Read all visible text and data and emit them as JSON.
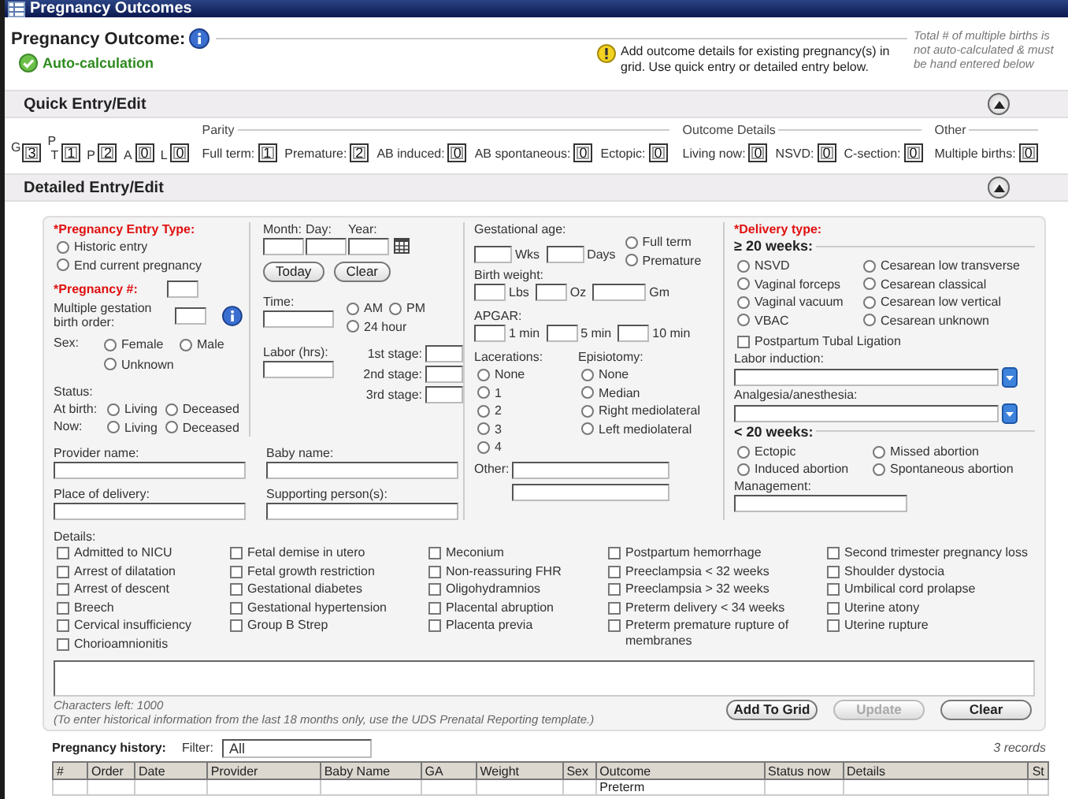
{
  "window": {
    "title": "Pregnancy Outcomes"
  },
  "header": {
    "title": "Pregnancy Outcome:",
    "auto_calc": "Auto-calculation",
    "notice": "Add outcome details for existing pregnancy(s) in grid. Use quick entry or detailed entry below.",
    "note": "Total # of multiple births is not auto-calculated & must be hand entered below"
  },
  "quick_entry": {
    "title": "Quick Entry/Edit",
    "expanded": true,
    "gravida": {
      "label": "G",
      "value": "3"
    },
    "para_label": "P",
    "para": [
      {
        "label": "T",
        "value": "1"
      },
      {
        "label": "P",
        "value": "2"
      },
      {
        "label": "A",
        "value": "0"
      },
      {
        "label": "L",
        "value": "0"
      }
    ],
    "groups": [
      {
        "title": "Parity",
        "fields": [
          {
            "label": "Full term:",
            "value": "1"
          },
          {
            "label": "Premature:",
            "value": "2"
          },
          {
            "label": "AB induced:",
            "value": "0"
          },
          {
            "label": "AB spontaneous:",
            "value": "0"
          },
          {
            "label": "Ectopic:",
            "value": "0"
          }
        ]
      },
      {
        "title": "Outcome Details",
        "fields": [
          {
            "label": "Living now:",
            "value": "0"
          },
          {
            "label": "NSVD:",
            "value": "0"
          },
          {
            "label": "C-section:",
            "value": "0"
          }
        ]
      },
      {
        "title": "Other",
        "fields": [
          {
            "label": "Multiple births:",
            "value": "0"
          }
        ]
      }
    ]
  },
  "detailed_entry": {
    "title": "Detailed Entry/Edit",
    "expanded": true,
    "entry_type": {
      "label": "*Pregnancy Entry Type:",
      "required": true,
      "options": [
        {
          "label": "Historic entry",
          "selected": false
        },
        {
          "label": "End current pregnancy",
          "selected": false
        }
      ]
    },
    "pregnancy_number": {
      "label": "*Pregnancy #:",
      "required": true
    },
    "birth_order": {
      "label": "Multiple gestation birth order:"
    },
    "sex": {
      "label": "Sex:",
      "options": [
        {
          "label": "Female",
          "selected": false
        },
        {
          "label": "Male",
          "selected": false
        },
        {
          "label": "Unknown",
          "selected": false
        }
      ]
    },
    "status": {
      "label": "Status:",
      "rows": [
        {
          "label": "At birth:",
          "options": [
            {
              "label": "Living",
              "selected": false
            },
            {
              "label": "Deceased",
              "selected": false
            }
          ]
        },
        {
          "label": "Now:",
          "options": [
            {
              "label": "Living",
              "selected": false
            },
            {
              "label": "Deceased",
              "selected": false
            }
          ]
        }
      ]
    },
    "date": {
      "labels": [
        "Month:",
        "Day:",
        "Year:"
      ],
      "buttons": [
        "Today",
        "Clear"
      ]
    },
    "time": {
      "label": "Time:",
      "options": [
        {
          "label": "AM",
          "selected": false
        },
        {
          "label": "PM",
          "selected": false
        },
        {
          "label": "24 hour",
          "selected": false
        }
      ]
    },
    "labor": {
      "label": "Labor (hrs):",
      "stages": [
        "1st stage:",
        "2nd stage:",
        "3rd stage:"
      ]
    },
    "text_fields": [
      {
        "label": "Provider name:"
      },
      {
        "label": "Baby name:"
      },
      {
        "label": "Place of delivery:"
      },
      {
        "label": "Supporting person(s):"
      }
    ],
    "gestational_age": {
      "label": "Gestational age:",
      "units": [
        "Wks",
        "Days"
      ],
      "options": [
        {
          "label": "Full term",
          "selected": false
        },
        {
          "label": "Premature",
          "selected": false
        }
      ]
    },
    "birth_weight": {
      "label": "Birth weight:",
      "units": [
        "Lbs",
        "Oz",
        "Gm"
      ]
    },
    "apgar": {
      "label": "APGAR:",
      "units": [
        "1 min",
        "5 min",
        "10 min"
      ]
    },
    "lacerations": {
      "label": "Lacerations:",
      "options": [
        {
          "label": "None",
          "selected": false
        },
        {
          "label": "1",
          "selected": false
        },
        {
          "label": "2",
          "selected": false
        },
        {
          "label": "3",
          "selected": false
        },
        {
          "label": "4",
          "selected": false
        }
      ]
    },
    "episiotomy": {
      "label": "Episiotomy:",
      "options": [
        {
          "label": "None",
          "selected": false
        },
        {
          "label": "Median",
          "selected": false
        },
        {
          "label": "Right mediolateral",
          "selected": false
        },
        {
          "label": "Left mediolateral",
          "selected": false
        }
      ]
    },
    "other": {
      "label": "Other:"
    },
    "delivery_type": {
      "label": "*Delivery type:",
      "required": true,
      "over_20": {
        "label": "≥ 20 weeks:",
        "options": [
          {
            "label": "NSVD",
            "selected": false
          },
          {
            "label": "Cesarean low transverse",
            "selected": false
          },
          {
            "label": "Vaginal forceps",
            "selected": false
          },
          {
            "label": "Cesarean classical",
            "selected": false
          },
          {
            "label": "Vaginal vacuum",
            "selected": false
          },
          {
            "label": "Cesarean low vertical",
            "selected": false
          },
          {
            "label": "VBAC",
            "selected": false
          },
          {
            "label": "Cesarean unknown",
            "selected": false
          }
        ]
      },
      "tubal_ligation": {
        "label": "Postpartum Tubal Ligation",
        "checked": false
      },
      "dropdowns": [
        {
          "label": "Labor induction:"
        },
        {
          "label": "Analgesia/anesthesia:"
        }
      ],
      "under_20": {
        "label": "< 20 weeks:",
        "options": [
          {
            "label": "Ectopic",
            "selected": false
          },
          {
            "label": "Missed abortion",
            "selected": false
          },
          {
            "label": "Induced abortion",
            "selected": false
          },
          {
            "label": "Spontaneous abortion",
            "selected": false
          }
        ]
      },
      "management": {
        "label": "Management:"
      }
    },
    "details": {
      "label": "Details:",
      "columns": [
        [
          {
            "label": "Admitted to NICU",
            "checked": false
          },
          {
            "label": "Arrest of dilatation",
            "checked": false
          },
          {
            "label": "Arrest of descent",
            "checked": false
          },
          {
            "label": "Breech",
            "checked": false
          },
          {
            "label": "Cervical insufficiency",
            "checked": false
          },
          {
            "label": "Chorioamnionitis",
            "checked": false
          }
        ],
        [
          {
            "label": "Fetal demise in utero",
            "checked": false
          },
          {
            "label": "Fetal growth restriction",
            "checked": false
          },
          {
            "label": "Gestational diabetes",
            "checked": false
          },
          {
            "label": "Gestational hypertension",
            "checked": false
          },
          {
            "label": "Group B Strep",
            "checked": false
          }
        ],
        [
          {
            "label": "Meconium",
            "checked": false
          },
          {
            "label": "Non-reassuring FHR",
            "checked": false
          },
          {
            "label": "Oligohydramnios",
            "checked": false
          },
          {
            "label": "Placental abruption",
            "checked": false
          },
          {
            "label": "Placenta previa",
            "checked": false
          }
        ],
        [
          {
            "label": "Postpartum hemorrhage",
            "checked": false
          },
          {
            "label": "Preeclampsia < 32 weeks",
            "checked": false
          },
          {
            "label": "Preeclampsia > 32 weeks",
            "checked": false
          },
          {
            "label": "Preterm delivery < 34 weeks",
            "checked": false
          },
          {
            "label": "Preterm premature rupture of membranes",
            "checked": false
          }
        ],
        [
          {
            "label": "Second trimester pregnancy loss",
            "checked": false
          },
          {
            "label": "Shoulder dystocia",
            "checked": false
          },
          {
            "label": "Umbilical cord prolapse",
            "checked": false
          },
          {
            "label": "Uterine atony",
            "checked": false
          },
          {
            "label": "Uterine rupture",
            "checked": false
          }
        ]
      ]
    },
    "characters_left": "Characters left: 1000",
    "hint": "(To enter historical information from the last 18 months only, use the UDS Prenatal Reporting template.)",
    "buttons": [
      {
        "label": "Add To Grid",
        "disabled": false
      },
      {
        "label": "Update",
        "disabled": true
      },
      {
        "label": "Clear",
        "disabled": false
      }
    ]
  },
  "history": {
    "label": "Pregnancy history:",
    "filter": {
      "label": "Filter:",
      "value": "All"
    },
    "count": "3 records",
    "columns": [
      "#",
      "Order",
      "Date",
      "Provider",
      "Baby Name",
      "GA",
      "Weight",
      "Sex",
      "Outcome",
      "Status now",
      "Details",
      "St"
    ],
    "rows": [
      [
        null,
        null,
        null,
        null,
        null,
        null,
        null,
        null,
        "Preterm",
        null,
        null,
        null
      ]
    ]
  }
}
